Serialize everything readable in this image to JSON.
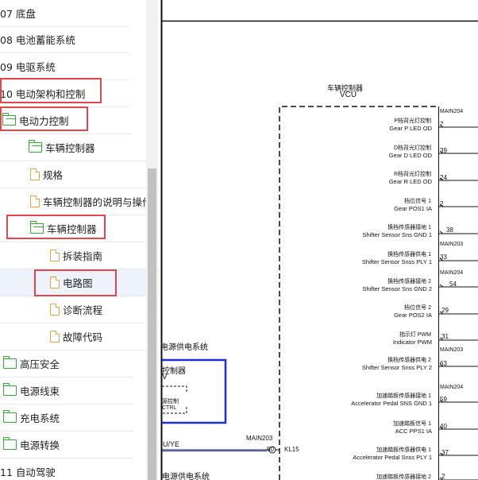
{
  "sidebar": {
    "items": [
      {
        "label": "07 底盘",
        "icon": "none"
      },
      {
        "label": "08 电池蓄能系统",
        "icon": "none"
      },
      {
        "label": "09 电驱系统",
        "icon": "none"
      },
      {
        "label": "10 电动架构和控制",
        "icon": "none"
      },
      {
        "label": "电动力控制",
        "icon": "folder-open-icon"
      },
      {
        "label": "车辆控制器",
        "icon": "folder-open-icon"
      },
      {
        "label": "规格",
        "icon": "document-icon"
      },
      {
        "label": "车辆控制器的说明与操作",
        "icon": "document-icon"
      },
      {
        "label": "车辆控制器",
        "icon": "folder-open-icon"
      },
      {
        "label": "拆装指南",
        "icon": "document-icon"
      },
      {
        "label": "电路图",
        "icon": "document-icon"
      },
      {
        "label": "诊断流程",
        "icon": "document-icon"
      },
      {
        "label": "故障代码",
        "icon": "document-icon"
      },
      {
        "label": "高压安全",
        "icon": "folder-icon"
      },
      {
        "label": "电源线束",
        "icon": "folder-icon"
      },
      {
        "label": "充电系统",
        "icon": "folder-icon"
      },
      {
        "label": "电源转换",
        "icon": "folder-icon"
      },
      {
        "label": "11 自动驾驶",
        "icon": "none"
      }
    ]
  },
  "diagram": {
    "vcu_title_cn": "车辆控制器",
    "vcu_title_en": "VCU",
    "power_label_1": "电源供电系统",
    "power_label_2": "电源供电系统",
    "ctrl_label_cn": "控制器",
    "ctrl_v": "V",
    "ctrl_sub_cn": "源控制",
    "ctrl_sub_en": "CTRL",
    "wire_label": "U/YE",
    "conn_main203_bottom": "MAIN203",
    "pin_50": "50",
    "kl15": "KL15",
    "connectors": [
      {
        "label": "MAIN204"
      },
      {
        "label": "MAIN203"
      },
      {
        "label": "MAIN204"
      },
      {
        "label": "MAIN203"
      },
      {
        "label": "MAIN204"
      }
    ],
    "pins": [
      {
        "cn": "P档背光灯控制",
        "en": "Gear P LED OD",
        "num": "7"
      },
      {
        "cn": "D档背光灯控制",
        "en": "Gear D LED OD",
        "num": "39"
      },
      {
        "cn": "R档背光灯控制",
        "en": "Gear R LED OD",
        "num": "24"
      },
      {
        "cn": "档位信号 1",
        "en": "Gear POS1 IA",
        "num": "2"
      },
      {
        "cn": "换档传感器接地 1",
        "en": "Shifter Sensor Sns GND 1",
        "num": "38"
      },
      {
        "cn": "换档传感器供电 1",
        "en": "Shifter Sensor Snss PLY 1",
        "num": "33"
      },
      {
        "cn": "换档传感器接地 2",
        "en": "Shifter Sensor Sns GND 2",
        "num": "54"
      },
      {
        "cn": "档位信号 2",
        "en": "Gear POS2 IA",
        "num": "29"
      },
      {
        "cn": "指示灯 PWM",
        "en": "Indicator PWM",
        "num": "31"
      },
      {
        "cn": "换档传感器供电 2",
        "en": "Shifter Sensor Snss PLY 2",
        "num": "63"
      },
      {
        "cn": "加速踏板传感器接地 1",
        "en": "Accelerator Pedal SNS GND 1",
        "num": "59"
      },
      {
        "cn": "加速踏板信号 1",
        "en": "ACC PPS1 IA",
        "num": "40"
      },
      {
        "cn": "加速踏板传感器供电 1",
        "en": "Accelerator Pedal Snss PLY 1",
        "num": "37"
      },
      {
        "cn": "加速踏板传感器接地 2",
        "en": "",
        "num": "2"
      }
    ]
  }
}
